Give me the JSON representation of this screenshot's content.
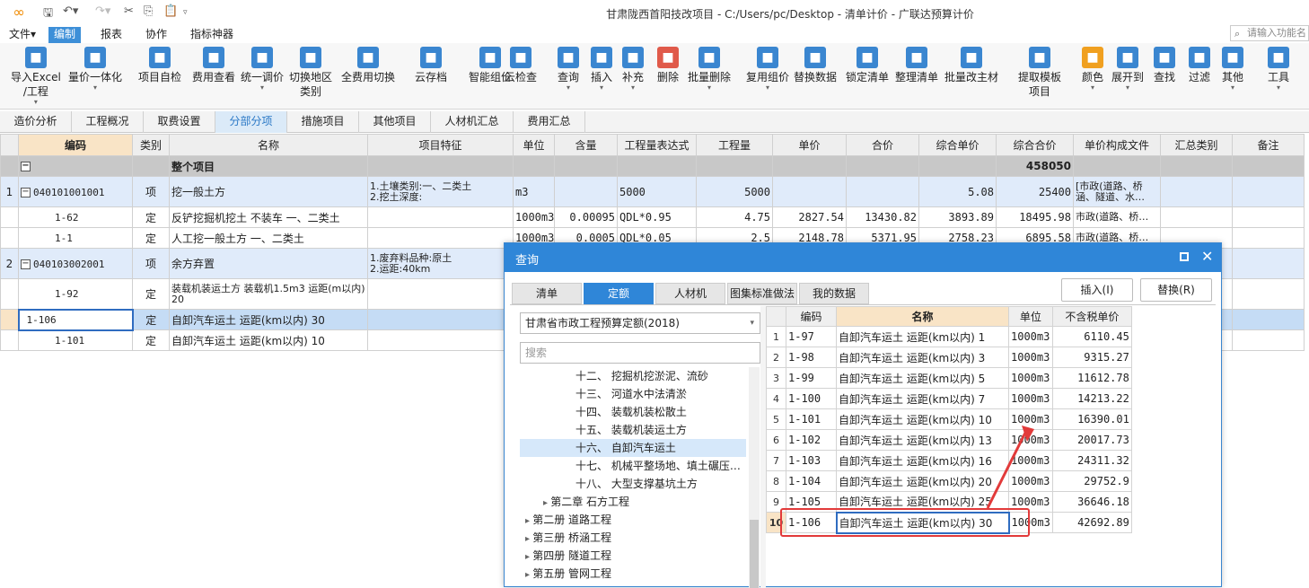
{
  "title_bar": {
    "title": "甘肃陇西首阳技改项目 - C:/Users/pc/Desktop - 清单计价 - 广联达预算计价"
  },
  "menu": {
    "items": [
      "文件▾",
      "编制",
      "报表",
      "协作",
      "指标神器"
    ],
    "search_placeholder": "请输入功能名"
  },
  "ribbon": {
    "buttons": [
      {
        "label": "导入Excel\n/工程",
        "icon": "import-excel-icon"
      },
      {
        "label": "量价一体化",
        "icon": "integration-icon"
      },
      {
        "label": "项目自检",
        "icon": "self-check-icon"
      },
      {
        "label": "费用查看",
        "icon": "cost-view-icon"
      },
      {
        "label": "统一调价",
        "icon": "price-adjust-icon"
      },
      {
        "label": "切换地区\n类别",
        "icon": "switch-region-icon"
      },
      {
        "label": "全费用切换",
        "icon": "full-cost-icon"
      },
      {
        "label": "云存档",
        "icon": "cloud-save-icon"
      },
      {
        "label": "智能组价",
        "icon": "smart-price-icon"
      },
      {
        "label": "云检查",
        "icon": "cloud-check-icon"
      },
      {
        "label": "查询",
        "icon": "query-icon"
      },
      {
        "label": "插入",
        "icon": "insert-icon"
      },
      {
        "label": "补充",
        "icon": "supplement-icon"
      },
      {
        "label": "删除",
        "icon": "delete-icon"
      },
      {
        "label": "批量删除",
        "icon": "batch-delete-icon"
      },
      {
        "label": "复用组价",
        "icon": "reuse-price-icon"
      },
      {
        "label": "替换数据",
        "icon": "replace-data-icon"
      },
      {
        "label": "锁定清单",
        "icon": "lock-icon"
      },
      {
        "label": "整理清单",
        "icon": "organize-icon"
      },
      {
        "label": "批量改主材",
        "icon": "batch-material-icon"
      },
      {
        "label": "提取模板\n项目",
        "icon": "template-icon"
      },
      {
        "label": "颜色",
        "icon": "color-icon"
      },
      {
        "label": "展开到",
        "icon": "expand-icon"
      },
      {
        "label": "查找",
        "icon": "find-icon"
      },
      {
        "label": "过滤",
        "icon": "filter-icon"
      },
      {
        "label": "其他",
        "icon": "other-icon"
      },
      {
        "label": "工具",
        "icon": "tool-icon"
      }
    ]
  },
  "tabs": [
    "造价分析",
    "工程概况",
    "取费设置",
    "分部分项",
    "措施项目",
    "其他项目",
    "人材机汇总",
    "费用汇总"
  ],
  "grid": {
    "headers": [
      "",
      "编码",
      "类别",
      "名称",
      "项目特征",
      "单位",
      "含量",
      "工程量表达式",
      "工程量",
      "单价",
      "合价",
      "综合单价",
      "综合合价",
      "单价构成文件",
      "汇总类别",
      "备注"
    ],
    "whole": {
      "minus": "−",
      "name": "整个项目",
      "total": "458050"
    },
    "rows": [
      {
        "rn": "1",
        "code": "040101001001",
        "type": "项",
        "name": "挖一般土方",
        "feature": "1.土壤类别:一、二类土\n2.挖土深度:",
        "unit": "m3",
        "qty_ratio": "",
        "expr": "5000",
        "qty": "5000",
        "price": "",
        "total": "",
        "unit_price": "5.08",
        "sum_price": "25400",
        "file": "[市政(道路、桥涵、隧道、水…"
      },
      {
        "rn": "",
        "code": "1-62",
        "type": "定",
        "name": "反铲挖掘机挖土 不装车 一、二类土",
        "feature": "",
        "unit": "1000m3",
        "qty_ratio": "0.00095",
        "expr": "QDL*0.95",
        "qty": "4.75",
        "price": "2827.54",
        "total": "13430.82",
        "unit_price": "3893.89",
        "sum_price": "18495.98",
        "file": "市政(道路、桥…"
      },
      {
        "rn": "",
        "code": "1-1",
        "type": "定",
        "name": "人工挖一般土方 一、二类土",
        "feature": "",
        "unit": "1000m3",
        "qty_ratio": "0.0005",
        "expr": "QDL*0.05",
        "qty": "2.5",
        "price": "2148.78",
        "total": "5371.95",
        "unit_price": "2758.23",
        "sum_price": "6895.58",
        "file": "市政(道路、桥…"
      },
      {
        "rn": "2",
        "code": "040103002001",
        "type": "项",
        "name": "余方弃置",
        "feature": "1.废弃料品种:原土\n2.运距:40km",
        "unit": "",
        "qty_ratio": "",
        "expr": "",
        "qty": "",
        "price": "",
        "total": "",
        "unit_price": "",
        "sum_price": "",
        "file": ""
      },
      {
        "rn": "",
        "code": "1-92",
        "type": "定",
        "name": "装载机装运土方 装载机1.5m3 运距(m以内) 20",
        "feature": "",
        "unit": "",
        "qty_ratio": "",
        "expr": "",
        "qty": "",
        "price": "",
        "total": "",
        "unit_price": "",
        "sum_price": "",
        "file": ""
      },
      {
        "rn": "",
        "code": "1-106",
        "type": "定",
        "name": "自卸汽车运土 运距(km以内) 30",
        "feature": "",
        "unit": "",
        "qty_ratio": "",
        "expr": "",
        "qty": "",
        "price": "",
        "total": "",
        "unit_price": "",
        "sum_price": "",
        "file": ""
      },
      {
        "rn": "",
        "code": "1-101",
        "type": "定",
        "name": "自卸汽车运土 运距(km以内) 10",
        "feature": "",
        "unit": "",
        "qty_ratio": "",
        "expr": "",
        "qty": "",
        "price": "",
        "total": "",
        "unit_price": "",
        "sum_price": "",
        "file": ""
      }
    ]
  },
  "dialog": {
    "title": "查询",
    "tabs": [
      "清单",
      "定额",
      "人材机",
      "图集标准做法",
      "我的数据"
    ],
    "insert_btn": "插入(I)",
    "replace_btn": "替换(R)",
    "quota_lib": "甘肃省市政工程预算定额(2018)",
    "search_placeholder": "搜索",
    "tree": [
      {
        "label": "十二、 挖掘机挖淤泥、流砂",
        "indent": 3,
        "arrow": ""
      },
      {
        "label": "十三、 河道水中法清淤",
        "indent": 3,
        "arrow": ""
      },
      {
        "label": "十四、 装载机装松散土",
        "indent": 3,
        "arrow": ""
      },
      {
        "label": "十五、 装载机装运土方",
        "indent": 3,
        "arrow": ""
      },
      {
        "label": "十六、 自卸汽车运土",
        "indent": 3,
        "arrow": ""
      },
      {
        "label": "十七、 机械平整场地、填土碾压…",
        "indent": 3,
        "arrow": ""
      },
      {
        "label": "十八、 大型支撑基坑土方",
        "indent": 3,
        "arrow": ""
      },
      {
        "label": "第二章 石方工程",
        "indent": 2,
        "arrow": "▸"
      },
      {
        "label": "第二册 道路工程",
        "indent": 1,
        "arrow": "▸"
      },
      {
        "label": "第三册 桥涵工程",
        "indent": 1,
        "arrow": "▸"
      },
      {
        "label": "第四册 隧道工程",
        "indent": 1,
        "arrow": "▸"
      },
      {
        "label": "第五册 管网工程",
        "indent": 1,
        "arrow": "▸"
      }
    ],
    "table_headers": [
      "",
      "编码",
      "名称",
      "单位",
      "不含税单价"
    ],
    "rows": [
      {
        "n": "1",
        "code": "1-97",
        "name": "自卸汽车运土 运距(km以内) 1",
        "unit": "1000m3",
        "price": "6110.45"
      },
      {
        "n": "2",
        "code": "1-98",
        "name": "自卸汽车运土 运距(km以内) 3",
        "unit": "1000m3",
        "price": "9315.27"
      },
      {
        "n": "3",
        "code": "1-99",
        "name": "自卸汽车运土 运距(km以内) 5",
        "unit": "1000m3",
        "price": "11612.78"
      },
      {
        "n": "4",
        "code": "1-100",
        "name": "自卸汽车运土 运距(km以内) 7",
        "unit": "1000m3",
        "price": "14213.22"
      },
      {
        "n": "5",
        "code": "1-101",
        "name": "自卸汽车运土 运距(km以内) 10",
        "unit": "1000m3",
        "price": "16390.01"
      },
      {
        "n": "6",
        "code": "1-102",
        "name": "自卸汽车运土 运距(km以内) 13",
        "unit": "1000m3",
        "price": "20017.73"
      },
      {
        "n": "7",
        "code": "1-103",
        "name": "自卸汽车运土 运距(km以内) 16",
        "unit": "1000m3",
        "price": "24311.32"
      },
      {
        "n": "8",
        "code": "1-104",
        "name": "自卸汽车运土 运距(km以内) 20",
        "unit": "1000m3",
        "price": "29752.9"
      },
      {
        "n": "9",
        "code": "1-105",
        "name": "自卸汽车运土 运距(km以内) 25",
        "unit": "1000m3",
        "price": "36646.18"
      },
      {
        "n": "10",
        "code": "1-106",
        "name": "自卸汽车运土 运距(km以内) 30",
        "unit": "1000m3",
        "price": "42692.89"
      }
    ]
  },
  "colors": {
    "accent": "#2f86d8",
    "highlight": "#e23a3a",
    "header_code": "#f9e4c6"
  }
}
